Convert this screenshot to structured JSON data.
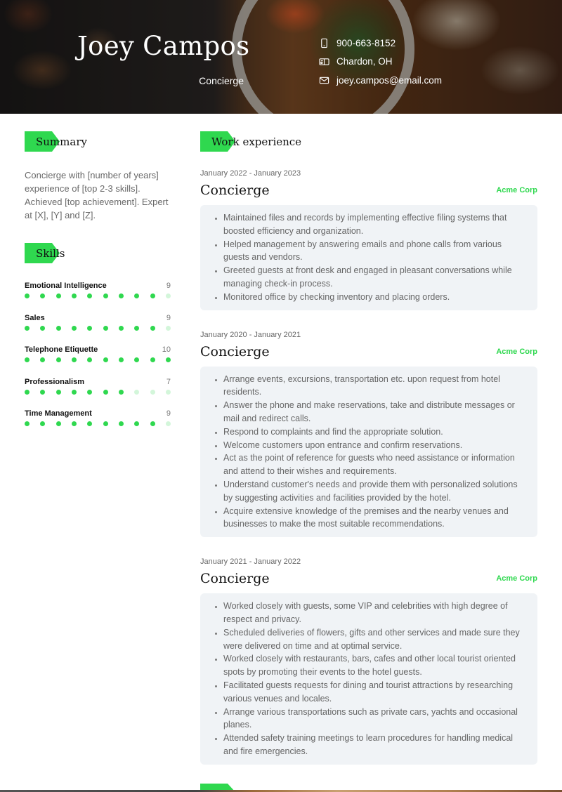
{
  "header": {
    "name": "Joey Campos",
    "role": "Concierge",
    "contacts": [
      {
        "icon": "phone-icon",
        "text": "900-663-8152"
      },
      {
        "icon": "mailbox-icon",
        "text": "Chardon, OH"
      },
      {
        "icon": "email-icon",
        "text": "joey.campos@email.com"
      }
    ]
  },
  "colors": {
    "accent": "#2fd84f",
    "accent_light": "#d3f6da",
    "box_background": "#f0f3f6"
  },
  "summary": {
    "heading": "Summary",
    "text": "Concierge with [number of years] experience of [top 2-3 skills]. Achieved [top achievement]. Expert at [X], [Y] and [Z]."
  },
  "skills": {
    "heading": "Skills",
    "max": 10,
    "items": [
      {
        "name": "Emotional Intelligence",
        "score": 9
      },
      {
        "name": "Sales",
        "score": 9
      },
      {
        "name": "Telephone Etiquette",
        "score": 10
      },
      {
        "name": "Professionalism",
        "score": 7
      },
      {
        "name": "Time Management",
        "score": 9
      }
    ]
  },
  "work": {
    "heading": "Work experience",
    "jobs": [
      {
        "dates": "January 2022 - January 2023",
        "title": "Concierge",
        "company": "Acme Corp",
        "bullets": [
          "Maintained files and records by implementing effective filing systems that boosted efficiency and organization.",
          "Helped management by answering emails and phone calls from various guests and vendors.",
          "Greeted guests at front desk and engaged in pleasant conversations while managing check-in process.",
          "Monitored office by checking inventory and placing orders."
        ]
      },
      {
        "dates": "January 2020 - January 2021",
        "title": "Concierge",
        "company": "Acme Corp",
        "bullets": [
          "Arrange events, excursions, transportation etc. upon request from hotel residents.",
          "Answer the phone and make reservations, take and distribute messages or mail and redirect calls.",
          "Respond to complaints and find the appropriate solution.",
          "Welcome customers upon entrance and confirm reservations.",
          "Act as the point of reference for guests who need assistance or information and attend to their wishes and requirements.",
          "Understand customer's needs and provide them with personalized solutions by suggesting activities and facilities provided by the hotel.",
          "Acquire extensive knowledge of the premises and the nearby venues and businesses to make the most suitable recommendations."
        ]
      },
      {
        "dates": "January 2021 - January 2022",
        "title": "Concierge",
        "company": "Acme Corp",
        "bullets": [
          "Worked closely with guests, some VIP and celebrities with high degree of respect and privacy.",
          "Scheduled deliveries of flowers, gifts and other services and made sure they were delivered on time and at optimal service.",
          "Worked closely with restaurants, bars, cafes and other local tourist oriented spots by promoting their events to the hotel guests.",
          "Facilitated guests requests for dining and tourist attractions by researching various venues and locales.",
          "Arrange various transportations such as private cars, yachts and occasional planes.",
          "Attended safety training meetings to learn procedures for handling medical and fire emergencies."
        ]
      }
    ]
  }
}
